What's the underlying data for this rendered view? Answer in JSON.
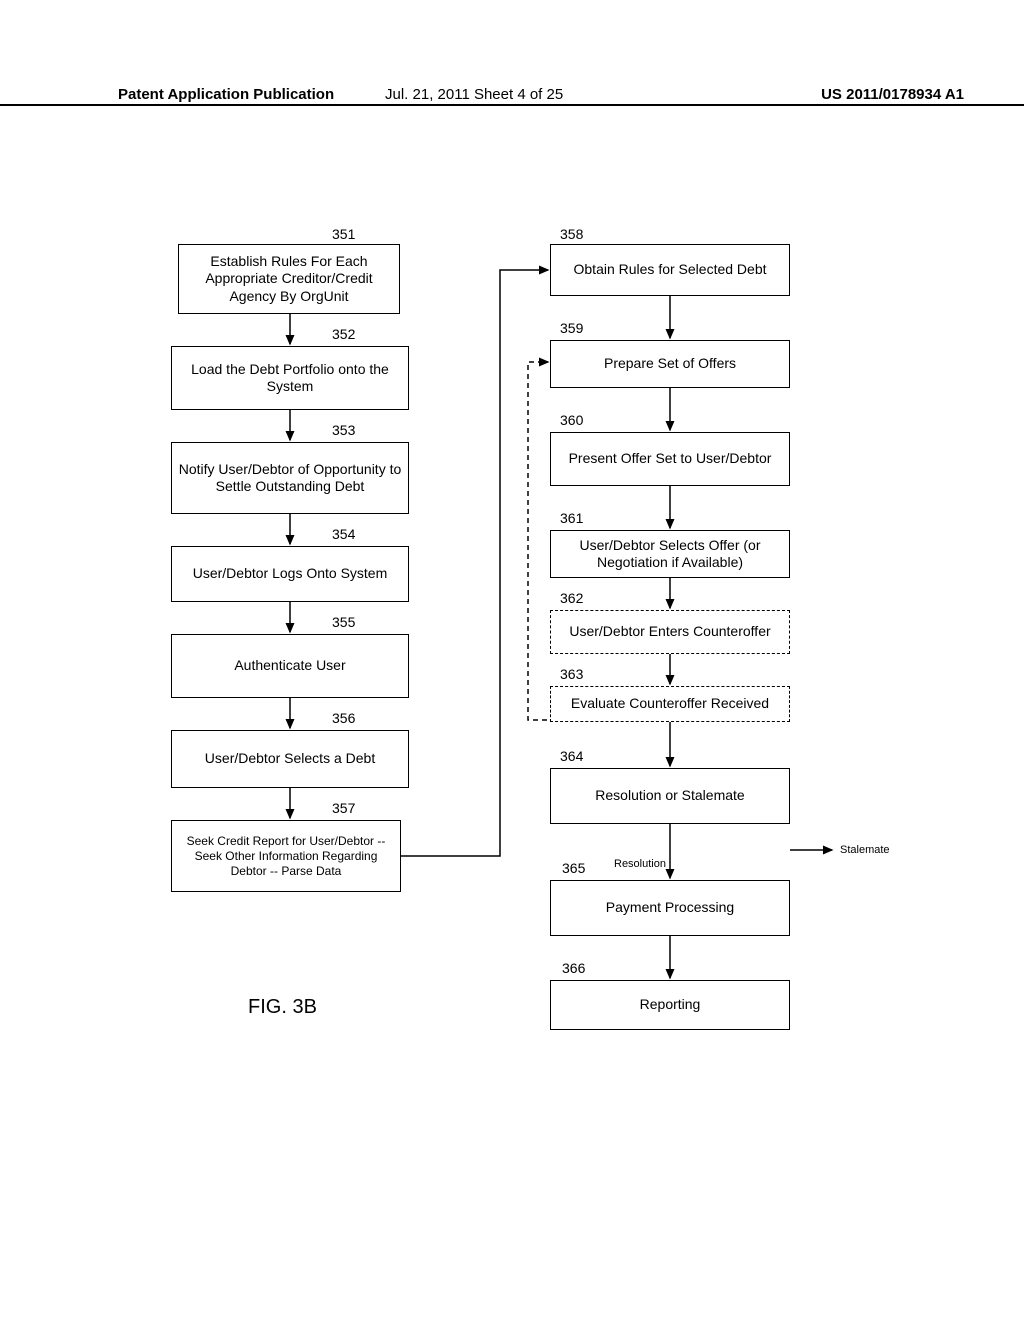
{
  "header": {
    "left": "Patent Application Publication",
    "center": "Jul. 21, 2011  Sheet 4 of 25",
    "right": "US 2011/0178934 A1"
  },
  "figure_caption": "FIG. 3B",
  "labels": {
    "resolution": "Resolution",
    "stalemate": "Stalemate"
  },
  "boxes": {
    "b351": {
      "num": "351",
      "text": "Establish Rules For Each Appropriate Creditor/Credit Agency By OrgUnit"
    },
    "b352": {
      "num": "352",
      "text": "Load the Debt Portfolio onto the System"
    },
    "b353": {
      "num": "353",
      "text": "Notify User/Debtor of Opportunity to Settle Outstanding Debt"
    },
    "b354": {
      "num": "354",
      "text": "User/Debtor Logs Onto System"
    },
    "b355": {
      "num": "355",
      "text": "Authenticate User"
    },
    "b356": {
      "num": "356",
      "text": "User/Debtor Selects a Debt"
    },
    "b357": {
      "num": "357",
      "text": "Seek Credit Report for User/Debtor -- Seek Other Information Regarding Debtor -- Parse Data"
    },
    "b358": {
      "num": "358",
      "text": "Obtain Rules for Selected Debt"
    },
    "b359": {
      "num": "359",
      "text": "Prepare Set of Offers"
    },
    "b360": {
      "num": "360",
      "text": "Present Offer Set to User/Debtor"
    },
    "b361": {
      "num": "361",
      "text": "User/Debtor Selects Offer (or Negotiation if Available)"
    },
    "b362": {
      "num": "362",
      "text": "User/Debtor Enters Counteroffer"
    },
    "b363": {
      "num": "363",
      "text": "Evaluate Counteroffer Received"
    },
    "b364": {
      "num": "364",
      "text": "Resolution or Stalemate"
    },
    "b365": {
      "num": "365",
      "text": "Payment Processing"
    },
    "b366": {
      "num": "366",
      "text": "Reporting"
    }
  }
}
